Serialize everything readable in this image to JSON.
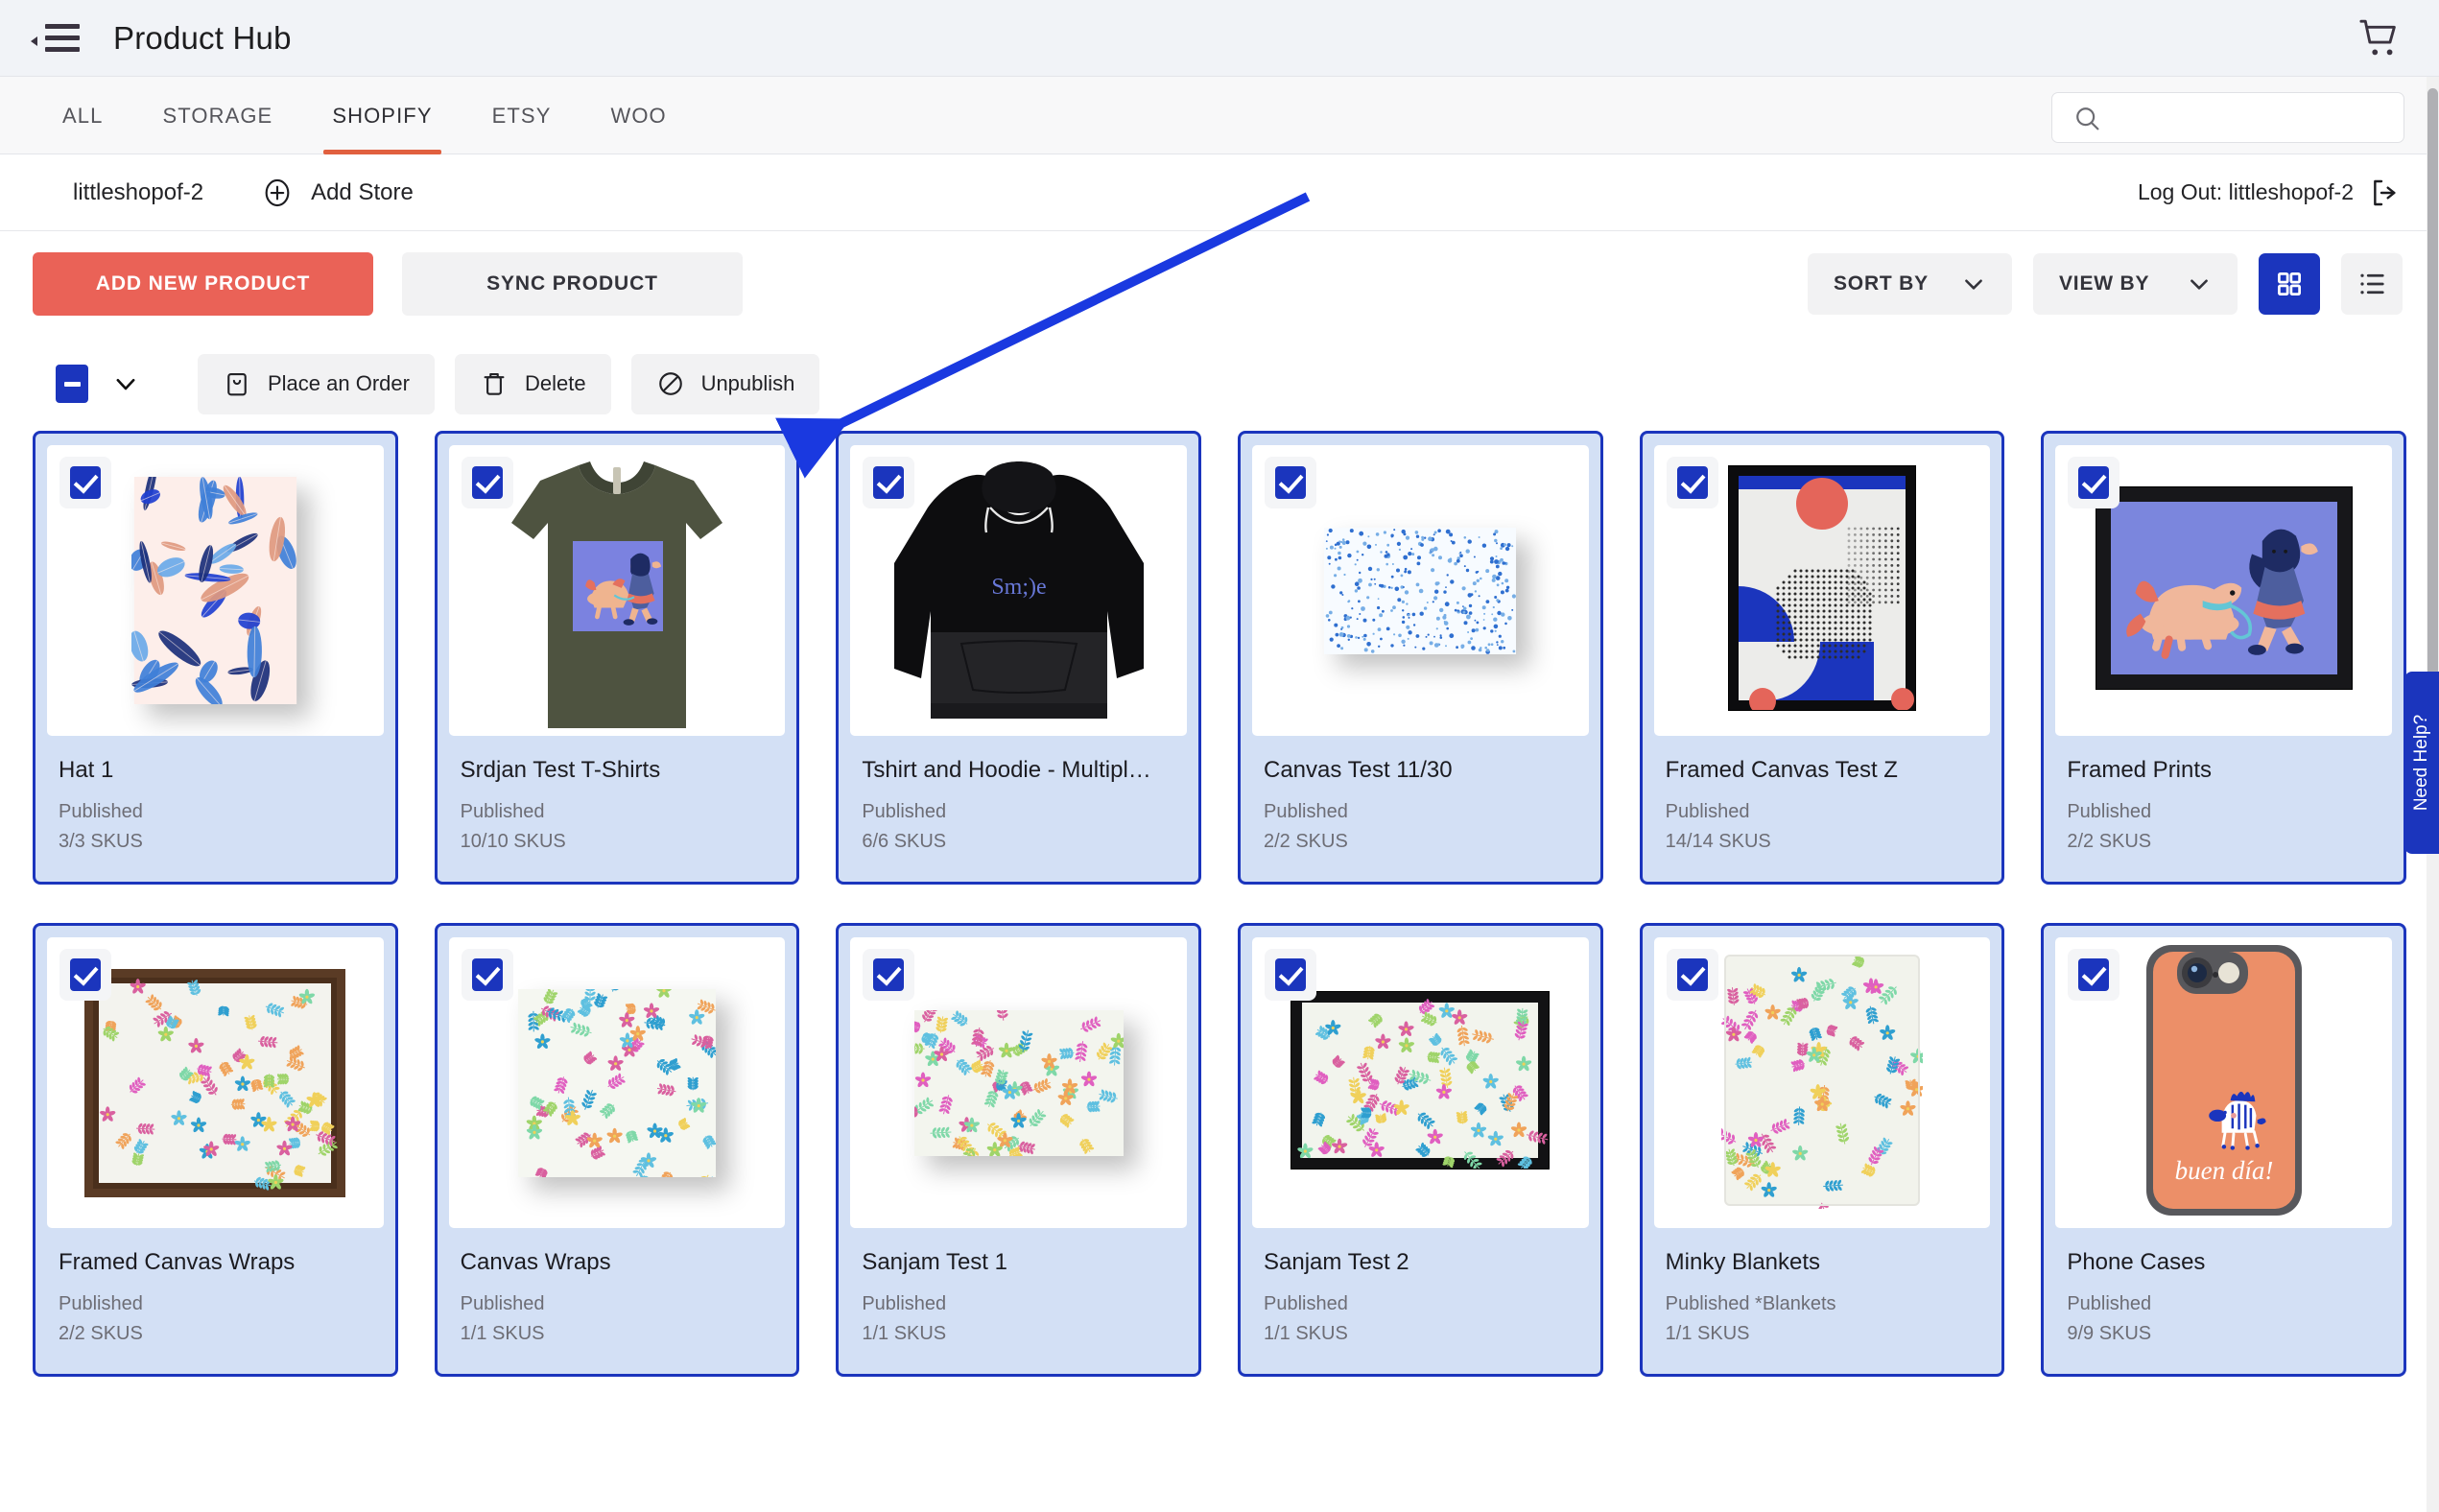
{
  "appbar": {
    "title": "Product Hub",
    "menu_icon": "hamburger-collapse-icon",
    "cart_icon": "shopping-cart-icon"
  },
  "tabs": [
    {
      "label": "ALL",
      "active": false
    },
    {
      "label": "STORAGE",
      "active": false
    },
    {
      "label": "SHOPIFY",
      "active": true
    },
    {
      "label": "ETSY",
      "active": false
    },
    {
      "label": "WOO",
      "active": false
    }
  ],
  "search": {
    "placeholder": "",
    "value": "",
    "icon": "search-icon"
  },
  "storebar": {
    "store_name": "littleshopof-2",
    "add_store_label": "Add Store",
    "add_store_icon": "plus-circle-icon",
    "logout_label": "Log Out: littleshopof-2",
    "logout_icon": "sign-out-icon"
  },
  "actions": {
    "add_new_product": "ADD NEW PRODUCT",
    "sync_product": "SYNC PRODUCT",
    "sort_by": "SORT BY",
    "view_by": "VIEW BY",
    "grid_view_icon": "grid-view-icon",
    "list_view_icon": "list-view-icon"
  },
  "bulk": {
    "select_all_state": "indeterminate",
    "dropdown_icon": "chevron-down-icon",
    "buttons": [
      {
        "label": "Place an Order",
        "icon": "shopping-bag-icon"
      },
      {
        "label": "Delete",
        "icon": "trash-icon"
      },
      {
        "label": "Unpublish",
        "icon": "no-entry-icon"
      }
    ]
  },
  "colors": {
    "accent_orange": "#e1603f",
    "primary_red": "#ea6257",
    "brand_blue": "#1b35bd",
    "card_selected_bg": "#d3e0f5",
    "annotation_blue": "#1a39e0"
  },
  "products": [
    {
      "title": "Hat 1",
      "status": "Published",
      "skus": "3/3 SKUS",
      "selected": true,
      "art": "leaf-pattern-box"
    },
    {
      "title": "Srdjan Test T-Shirts",
      "status": "Published",
      "skus": "10/10 SKUS",
      "selected": true,
      "art": "olive-tshirt"
    },
    {
      "title": "Tshirt and Hoodie - Multipl…",
      "status": "Published",
      "skus": "6/6 SKUS",
      "selected": true,
      "art": "black-hoodie"
    },
    {
      "title": "Canvas Test 11/30",
      "status": "Published",
      "skus": "2/2 SKUS",
      "selected": true,
      "art": "dotted-canvas"
    },
    {
      "title": "Framed Canvas Test Z",
      "status": "Published",
      "skus": "14/14 SKUS",
      "selected": true,
      "art": "geometric-framed-canvas"
    },
    {
      "title": "Framed Prints",
      "status": "Published",
      "skus": "2/2 SKUS",
      "selected": true,
      "art": "dog-girl-framed-print"
    },
    {
      "title": "Framed Canvas Wraps",
      "status": "Published",
      "skus": "2/2 SKUS",
      "selected": true,
      "art": "floral-wood-frame"
    },
    {
      "title": "Canvas Wraps",
      "status": "Published",
      "skus": "1/1 SKUS",
      "selected": true,
      "art": "floral-wrap-square"
    },
    {
      "title": "Sanjam Test 1",
      "status": "Published",
      "skus": "1/1 SKUS",
      "selected": true,
      "art": "floral-canvas-landscape"
    },
    {
      "title": "Sanjam Test 2",
      "status": "Published",
      "skus": "1/1 SKUS",
      "selected": true,
      "art": "floral-black-frame"
    },
    {
      "title": "Minky Blankets",
      "status": "Published *Blankets",
      "skus": "1/1 SKUS",
      "selected": true,
      "art": "floral-blanket"
    },
    {
      "title": "Phone Cases",
      "status": "Published",
      "skus": "9/9 SKUS",
      "selected": true,
      "art": "orange-phone-case"
    }
  ],
  "help": {
    "label": "Need Help?"
  }
}
